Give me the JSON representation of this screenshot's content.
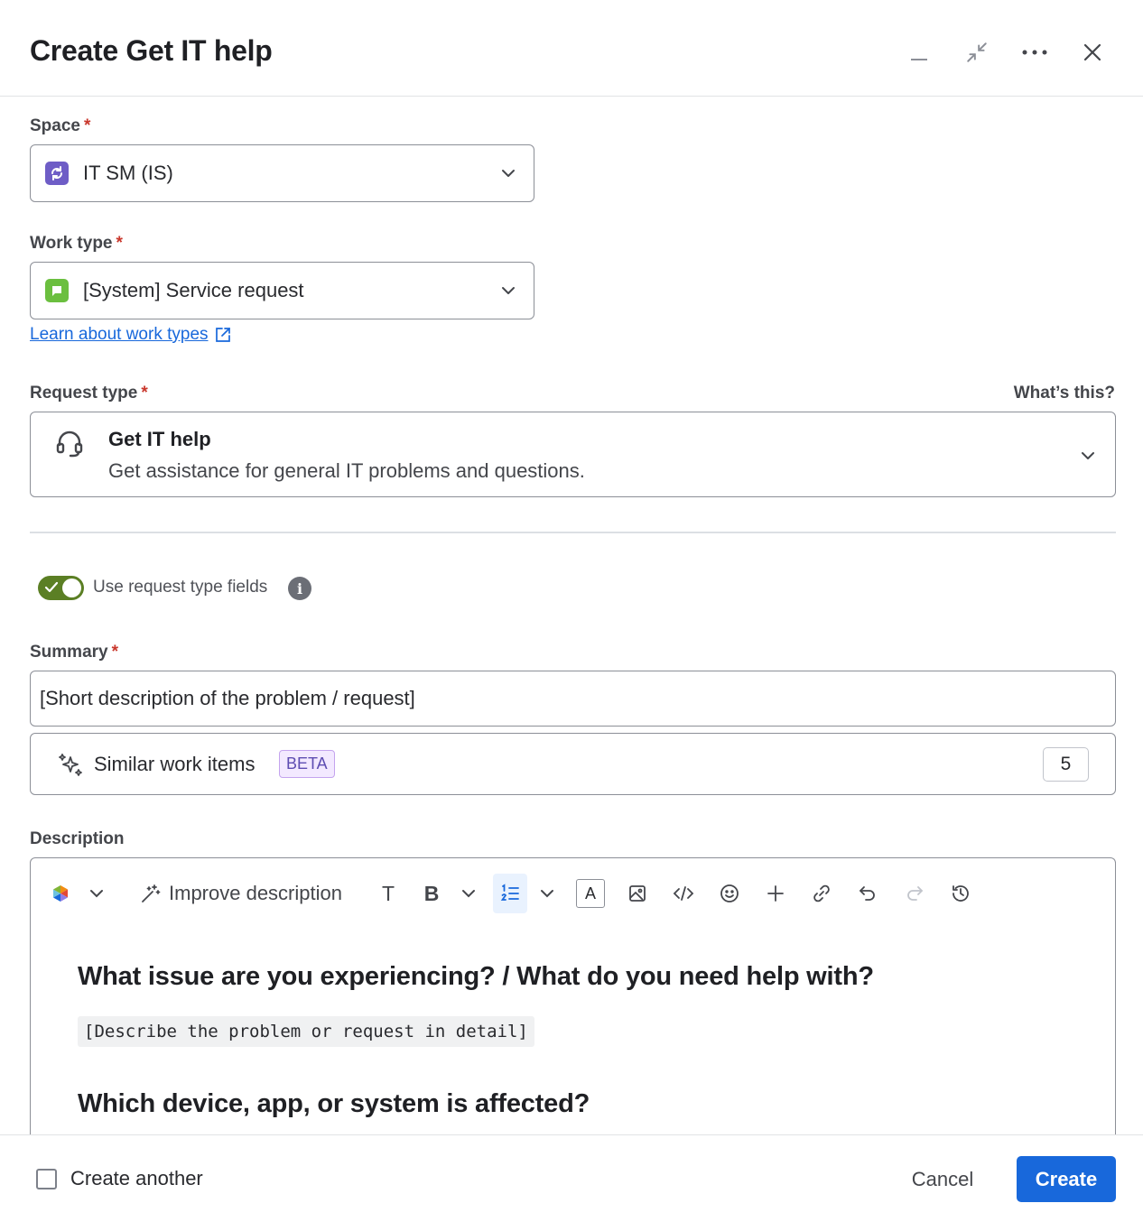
{
  "dialog": {
    "title": "Create Get IT help"
  },
  "header_actions": [
    "minimize-icon",
    "collapse-icon",
    "more-icon",
    "close-icon"
  ],
  "space": {
    "label": "Space",
    "required_mark": "*",
    "value": "IT SM (IS)"
  },
  "work_type": {
    "label": "Work type",
    "required_mark": "*",
    "value": "[System] Service request",
    "learn_link": "Learn about work types"
  },
  "request_type": {
    "label": "Request type",
    "required_mark": "*",
    "whats_this": "What’s this?",
    "name": "Get IT help",
    "description": "Get assistance for general IT problems and questions."
  },
  "toggle": {
    "label": "Use request type fields",
    "checked": true,
    "info_glyph": "i"
  },
  "summary": {
    "label": "Summary",
    "required_mark": "*",
    "value": "[Short description of the problem / request]"
  },
  "similar": {
    "label": "Similar work items",
    "badge": "BETA",
    "count": "5"
  },
  "description": {
    "label": "Description",
    "toolbar": {
      "improve_label": "Improve description",
      "text_style_glyph": "T",
      "bold_glyph": "B",
      "text_color_glyph": "A"
    },
    "content": {
      "heading1": "What issue are you experiencing? / What do you need help with?",
      "placeholder1": "[Describe the problem or request in detail]",
      "heading2": "Which device, app, or system is affected?"
    }
  },
  "footer": {
    "create_another": "Create another",
    "cancel": "Cancel",
    "create": "Create"
  },
  "colors": {
    "primary": "#1868db",
    "toggle_on": "#5b7f24",
    "required": "#c9372c",
    "beta_bg": "#f3e9ff"
  }
}
